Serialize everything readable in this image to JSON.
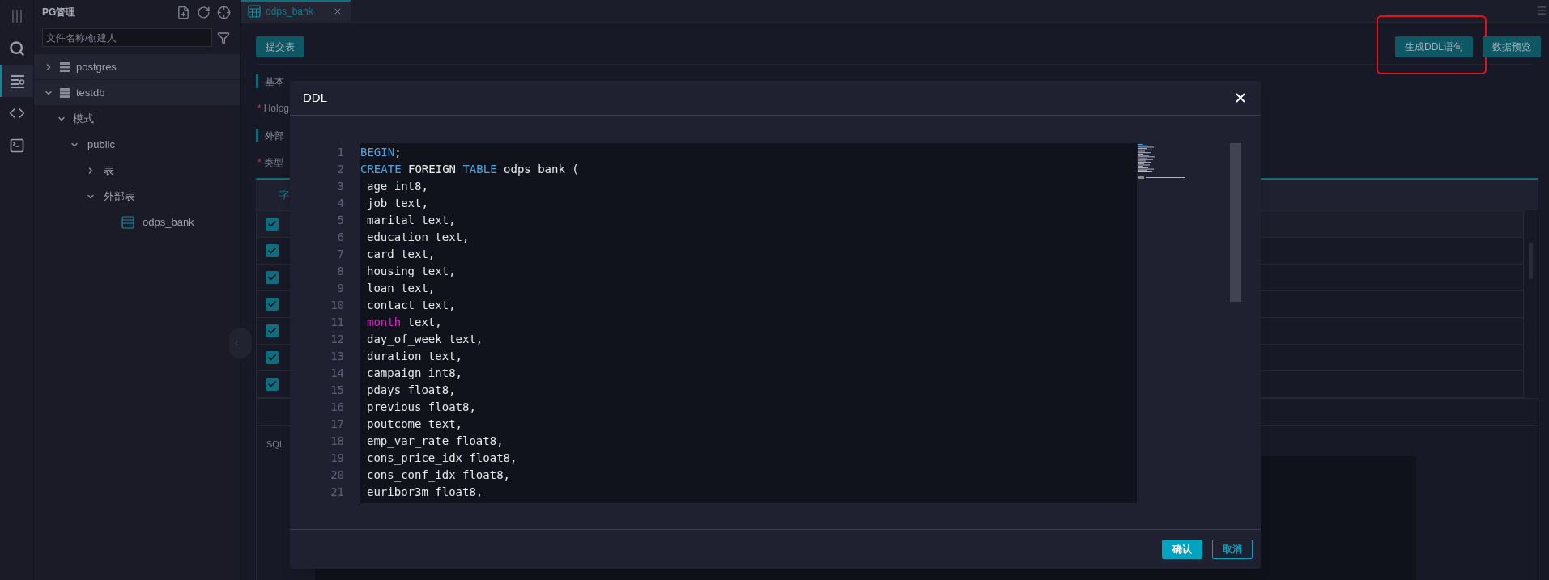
{
  "activity_bar": [
    {
      "kind": "menu",
      "selected": false
    },
    {
      "kind": "search",
      "selected": false
    },
    {
      "kind": "list",
      "selected": true
    },
    {
      "kind": "code",
      "selected": false
    },
    {
      "kind": "terminal",
      "selected": false
    }
  ],
  "sidebar": {
    "title": "PG管理",
    "search": {
      "placeholder": "文件名称/创建人"
    },
    "tree": [
      {
        "label": "postgres",
        "kind": "database",
        "expanded": false
      },
      {
        "label": "testdb",
        "kind": "database",
        "expanded": true,
        "children": [
          {
            "label": "模式",
            "expanded": true,
            "children": [
              {
                "label": "public",
                "expanded": true,
                "children": [
                  {
                    "label": "表",
                    "expanded": false
                  },
                  {
                    "label": "外部表",
                    "expanded": true,
                    "children": [
                      {
                        "label": "odps_bank",
                        "kind": "table"
                      }
                    ]
                  }
                ]
              }
            ]
          }
        ]
      }
    ]
  },
  "tabs": [
    {
      "label": "odps_bank",
      "selected": true
    }
  ],
  "toolbar": {
    "left": [
      {
        "label": "提交表",
        "highlighted": false
      }
    ],
    "right": [
      {
        "label": "生成DDL语句",
        "highlighted": true
      },
      {
        "label": "数据预览",
        "highlighted": false
      }
    ]
  },
  "form": [
    {
      "kind": "section",
      "label": "基本"
    },
    {
      "kind": "field",
      "label": "Holog",
      "required_mark": "*"
    },
    {
      "kind": "section",
      "label": "外部"
    },
    {
      "kind": "field",
      "label": "类型",
      "required_mark": "*"
    }
  ],
  "table": {
    "tabs": [
      {
        "label": "字",
        "selected": true
      }
    ],
    "select_all": {
      "checked": true
    },
    "rows": [
      {
        "checked": true
      },
      {
        "checked": true
      },
      {
        "checked": true
      },
      {
        "checked": true
      },
      {
        "checked": true
      },
      {
        "checked": true
      }
    ]
  },
  "sql_section": {
    "label": "SQL"
  },
  "dialog": {
    "title": "DDL",
    "lines": [
      {
        "number": "1",
        "indented": false,
        "tokens": [
          {
            "text": "BEGIN",
            "kind": "keyword"
          },
          {
            "text": ";",
            "kind": "plain"
          }
        ]
      },
      {
        "number": "2",
        "indented": false,
        "tokens": [
          {
            "text": "CREATE",
            "kind": "keyword"
          },
          {
            "text": " FOREIGN ",
            "kind": "plain"
          },
          {
            "text": "TABLE",
            "kind": "keyword"
          },
          {
            "text": " odps_bank (",
            "kind": "plain"
          }
        ]
      },
      {
        "number": "3",
        "indented": true,
        "tokens": [
          {
            "text": "age int8,",
            "kind": "plain"
          }
        ]
      },
      {
        "number": "4",
        "indented": true,
        "tokens": [
          {
            "text": "job text,",
            "kind": "plain"
          }
        ]
      },
      {
        "number": "5",
        "indented": true,
        "tokens": [
          {
            "text": "marital text,",
            "kind": "plain"
          }
        ]
      },
      {
        "number": "6",
        "indented": true,
        "tokens": [
          {
            "text": "education text,",
            "kind": "plain"
          }
        ]
      },
      {
        "number": "7",
        "indented": true,
        "tokens": [
          {
            "text": "card text,",
            "kind": "plain"
          }
        ]
      },
      {
        "number": "8",
        "indented": true,
        "tokens": [
          {
            "text": "housing text,",
            "kind": "plain"
          }
        ]
      },
      {
        "number": "9",
        "indented": true,
        "tokens": [
          {
            "text": "loan text,",
            "kind": "plain"
          }
        ]
      },
      {
        "number": "10",
        "indented": true,
        "tokens": [
          {
            "text": "contact text,",
            "kind": "plain"
          }
        ]
      },
      {
        "number": "11",
        "indented": true,
        "tokens": [
          {
            "text": "month",
            "kind": "builtin"
          },
          {
            "text": " text,",
            "kind": "plain"
          }
        ]
      },
      {
        "number": "12",
        "indented": true,
        "tokens": [
          {
            "text": "day_of_week text,",
            "kind": "plain"
          }
        ]
      },
      {
        "number": "13",
        "indented": true,
        "tokens": [
          {
            "text": "duration text,",
            "kind": "plain"
          }
        ]
      },
      {
        "number": "14",
        "indented": true,
        "tokens": [
          {
            "text": "campaign int8,",
            "kind": "plain"
          }
        ]
      },
      {
        "number": "15",
        "indented": true,
        "tokens": [
          {
            "text": "pdays float8,",
            "kind": "plain"
          }
        ]
      },
      {
        "number": "16",
        "indented": true,
        "tokens": [
          {
            "text": "previous float8,",
            "kind": "plain"
          }
        ]
      },
      {
        "number": "17",
        "indented": true,
        "tokens": [
          {
            "text": "poutcome text,",
            "kind": "plain"
          }
        ]
      },
      {
        "number": "18",
        "indented": true,
        "tokens": [
          {
            "text": "emp_var_rate float8,",
            "kind": "plain"
          }
        ]
      },
      {
        "number": "19",
        "indented": true,
        "tokens": [
          {
            "text": "cons_price_idx float8,",
            "kind": "plain"
          }
        ]
      },
      {
        "number": "20",
        "indented": true,
        "tokens": [
          {
            "text": "cons_conf_idx float8,",
            "kind": "plain"
          }
        ]
      },
      {
        "number": "21",
        "indented": true,
        "tokens": [
          {
            "text": "euribor3m float8,",
            "kind": "plain"
          }
        ]
      }
    ],
    "buttons": [
      {
        "label": "确认",
        "kind": "primary"
      },
      {
        "label": "取消",
        "kind": "secondary"
      }
    ]
  }
}
